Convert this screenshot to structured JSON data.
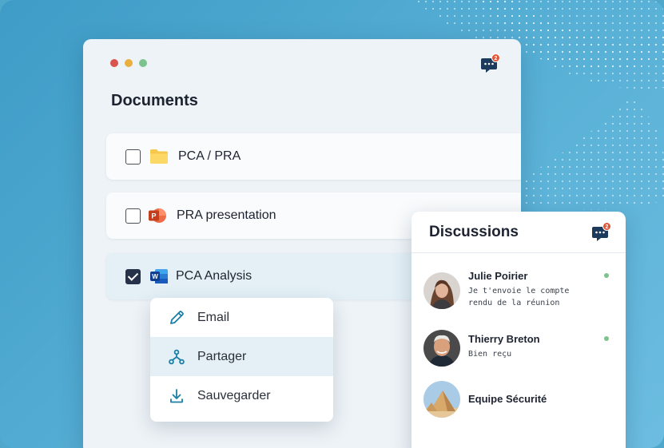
{
  "colors": {
    "background": "#4fa8cc",
    "accent": "#1b7fa6",
    "checkbox_checked": "#27324a",
    "notification": "#e05535",
    "online": "#7cc38d"
  },
  "window": {
    "title": "Documents",
    "chat_badge": "2",
    "chat_icon": "chat-bubble-icon"
  },
  "documents": [
    {
      "label": "PCA / PRA",
      "icon": "folder-icon",
      "checked": false
    },
    {
      "label": "PRA presentation",
      "icon": "powerpoint-icon",
      "checked": false
    },
    {
      "label": "PCA Analysis",
      "icon": "word-icon",
      "checked": true
    }
  ],
  "context_menu": {
    "items": [
      {
        "label": "Email",
        "icon": "pencil-icon"
      },
      {
        "label": "Partager",
        "icon": "share-icon",
        "active": true
      },
      {
        "label": "Sauvegarder",
        "icon": "download-icon"
      }
    ]
  },
  "discussions": {
    "title": "Discussions",
    "chat_badge": "2",
    "contacts": [
      {
        "name": "Julie Poirier",
        "message": "Je t'envoie le compte rendu de la réunion",
        "online": true
      },
      {
        "name": "Thierry Breton",
        "message": "Bien reçu",
        "online": true
      },
      {
        "name": "Equipe Sécurité",
        "message": "",
        "online": false
      }
    ]
  }
}
